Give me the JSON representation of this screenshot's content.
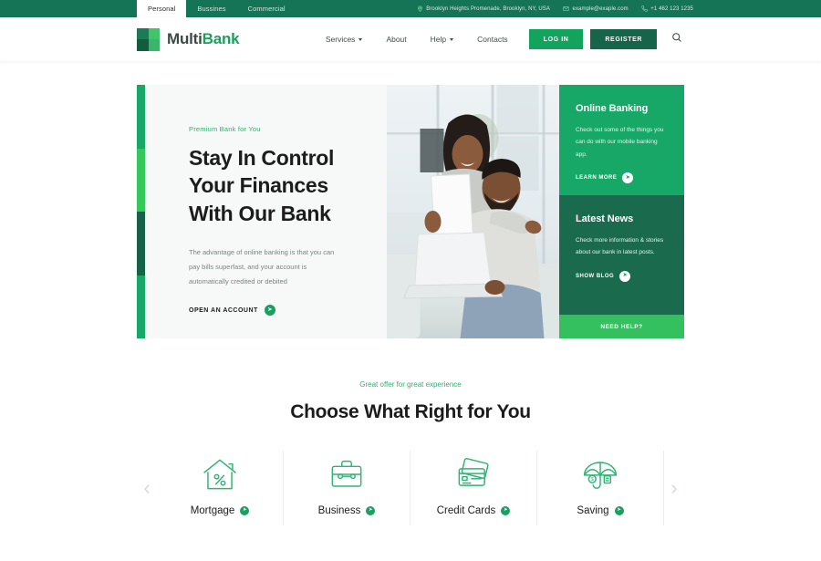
{
  "topbar": {
    "tabs": [
      {
        "label": "Personal",
        "active": true
      },
      {
        "label": "Bussines",
        "active": false
      },
      {
        "label": "Commercial",
        "active": false
      }
    ],
    "address": "Brooklyn Heights Promenade, Brooklyn, NY, USA",
    "email": "example@exaple.com",
    "phone": "+1 462 123 1235",
    "icons": {
      "location": "location-pin-icon",
      "mail": "mail-icon",
      "phone": "phone-icon"
    }
  },
  "header": {
    "logo": {
      "name_part1": "Multi",
      "name_part2": "Bank"
    },
    "nav": [
      {
        "label": "Services",
        "has_dropdown": true
      },
      {
        "label": "About",
        "has_dropdown": false
      },
      {
        "label": "Help",
        "has_dropdown": true
      },
      {
        "label": "Contacts",
        "has_dropdown": false
      }
    ],
    "login_label": "LOG IN",
    "register_label": "REGISTER",
    "search_icon": "search-icon"
  },
  "hero": {
    "eyebrow": "Premium Bank for You",
    "title_line1": "Stay In Control",
    "title_line2": "Your Finances",
    "title_line3": "With Our Bank",
    "paragraph": "The advantage of online banking is that you can pay bills superfast, and your account is automatically credited or debited",
    "cta_label": "OPEN AN ACCOUNT",
    "panels": [
      {
        "title": "Online Banking",
        "text": "Check out some of the things you can do with our mobile banking app.",
        "cta_label": "LEARN MORE"
      },
      {
        "title": "Latest News",
        "text": "Check more information & stories about our bank in latest posts.",
        "cta_label": "SHOW BLOG"
      }
    ],
    "need_help_label": "NEED HELP?"
  },
  "offers": {
    "eyebrow": "Great offer for great experience",
    "title": "Choose What Right for You",
    "prev_icon": "chevron-left-icon",
    "next_icon": "chevron-right-icon",
    "cards": [
      {
        "label": "Mortgage",
        "icon": "house-percent-icon"
      },
      {
        "label": "Business",
        "icon": "briefcase-icon"
      },
      {
        "label": "Credit Cards",
        "icon": "credit-cards-icon"
      },
      {
        "label": "Saving",
        "icon": "umbrella-icon"
      }
    ]
  },
  "colors": {
    "dark_green": "#157356",
    "green": "#17a766",
    "bright_green": "#34c759",
    "deep_green": "#16644a",
    "accent": "#19a05e"
  }
}
